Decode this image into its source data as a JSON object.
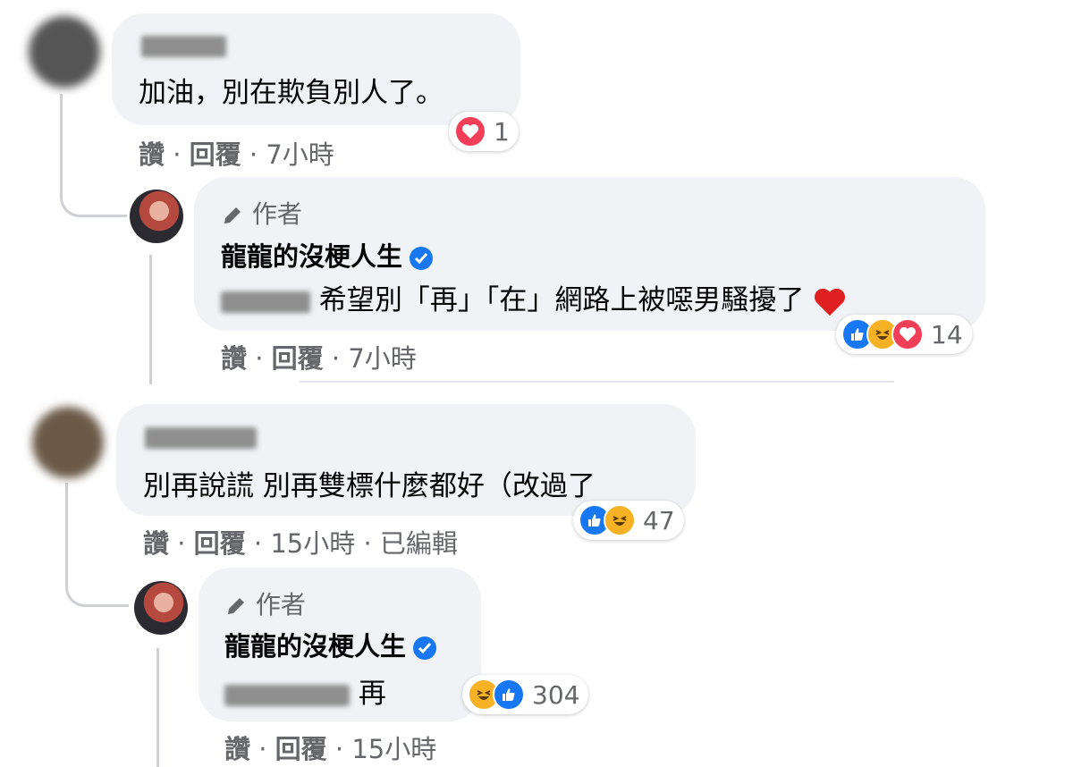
{
  "comments": [
    {
      "text": "加油，別在欺負別人了。",
      "meta": {
        "like": "讚",
        "reply": "回覆",
        "time": "7小時",
        "edited": ""
      },
      "reactions": {
        "count": "1"
      }
    },
    {
      "author_tag": "作者",
      "author_name": "龍龍的沒梗人生",
      "text": "希望別「再」「在」網路上被噁男騷擾了",
      "meta": {
        "like": "讚",
        "reply": "回覆",
        "time": "7小時"
      },
      "reactions": {
        "count": "14"
      }
    },
    {
      "text": "別再說謊 別再雙標什麼都好（改過了",
      "meta": {
        "like": "讚",
        "reply": "回覆",
        "time": "15小時",
        "edited": "已編輯"
      },
      "reactions": {
        "count": "47"
      }
    },
    {
      "author_tag": "作者",
      "author_name": "龍龍的沒梗人生",
      "text": "再",
      "meta": {
        "like": "讚",
        "reply": "回覆",
        "time": "15小時"
      },
      "reactions": {
        "count": "304"
      }
    }
  ],
  "colors": {
    "like": "#1877f2",
    "haha": "#f7b125",
    "love": "#f33e58",
    "bubble": "#f0f2f5",
    "meta": "#65676b"
  },
  "icons": [
    "heart-icon",
    "like-icon",
    "haha-icon",
    "pencil-icon",
    "verified-badge-icon"
  ]
}
